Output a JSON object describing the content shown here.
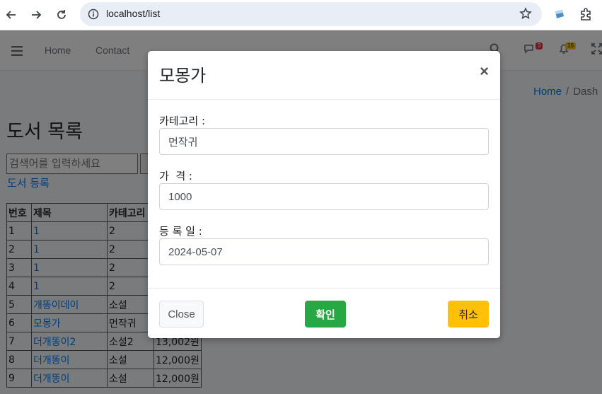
{
  "browser": {
    "url": "localhost/list"
  },
  "topnav": {
    "links": [
      "Home",
      "Contact"
    ],
    "messages_badge": "3",
    "notifications_badge": "15"
  },
  "breadcrumb": {
    "home": "Home",
    "current": "Dash"
  },
  "page": {
    "title": "도서 목록",
    "search_placeholder": "검색어를 입력하세요",
    "register_link": "도서 등록"
  },
  "table": {
    "headers": [
      "번호",
      "제목",
      "카테고리"
    ],
    "rows": [
      {
        "no": "1",
        "title": "1",
        "category": "2",
        "price": ""
      },
      {
        "no": "2",
        "title": "1",
        "category": "2",
        "price": ""
      },
      {
        "no": "3",
        "title": "1",
        "category": "2",
        "price": ""
      },
      {
        "no": "4",
        "title": "1",
        "category": "2",
        "price": ""
      },
      {
        "no": "5",
        "title": "개똥이데이",
        "category": "소설",
        "price": ""
      },
      {
        "no": "6",
        "title": "모몽가",
        "category": "먼작귀",
        "price": ""
      },
      {
        "no": "7",
        "title": "더개똥이2",
        "category": "소설2",
        "price": "13,002원"
      },
      {
        "no": "8",
        "title": "더개똥이",
        "category": "소설",
        "price": "12,000원"
      },
      {
        "no": "9",
        "title": "더개똥이",
        "category": "소설",
        "price": "12,000원"
      }
    ]
  },
  "modal": {
    "title": "모몽가",
    "close_symbol": "×",
    "category_label": "카테고리 :",
    "category_value": "먼작귀",
    "price_label": "가  격 :",
    "price_value": "1000",
    "date_label": "등 록 일 :",
    "date_value": "2024-05-07",
    "btn_close": "Close",
    "btn_ok": "확인",
    "btn_cancel": "취소"
  },
  "colors": {
    "accent": "#007bff",
    "ok": "#28a745",
    "cancel": "#ffc107",
    "badge_red": "#dc3545",
    "badge_yellow": "#ffc107"
  }
}
